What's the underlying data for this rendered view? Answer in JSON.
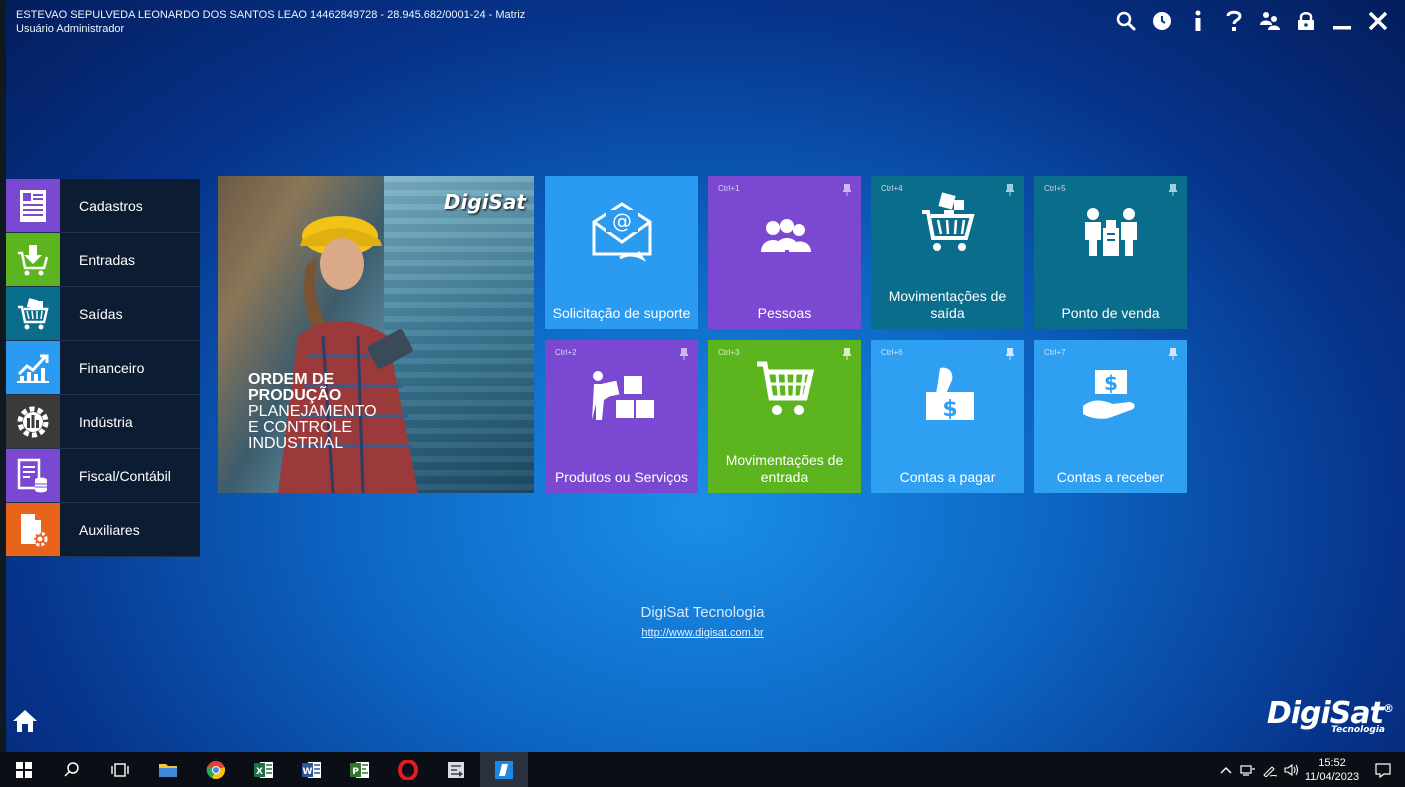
{
  "header": {
    "company_line": "ESTEVAO SEPULVEDA LEONARDO DOS SANTOS LEAO 14462849728 - 28.945.682/0001-24 - Matriz",
    "user_line": "Usuário Administrador"
  },
  "top_icons": [
    "search-icon",
    "history-icon",
    "info-icon",
    "help-icon",
    "switch-user-icon",
    "lock-icon",
    "minimize-icon",
    "close-icon"
  ],
  "menu": {
    "items": [
      {
        "label": "Cadastros",
        "color": "#7a48d1",
        "icon": "registry-icon"
      },
      {
        "label": "Entradas",
        "color": "#5cb51e",
        "icon": "cart-in-icon"
      },
      {
        "label": "Saídas",
        "color": "#0a6d8c",
        "icon": "cart-out-icon"
      },
      {
        "label": "Financeiro",
        "color": "#2b9bf1",
        "icon": "chart-icon"
      },
      {
        "label": "Indústria",
        "color": "#3a3a3a",
        "icon": "gear-icon"
      },
      {
        "label": "Fiscal/Contábil",
        "color": "#7a48d1",
        "icon": "tax-icon"
      },
      {
        "label": "Auxiliares",
        "color": "#e8631c",
        "icon": "aux-icon"
      }
    ]
  },
  "banner": {
    "logo": "DigiSat",
    "line1": "ORDEM DE",
    "line2": "PRODUÇÃO",
    "line3": "PLANEJAMENTO",
    "line4": "E CONTROLE",
    "line5": "INDUSTRIAL"
  },
  "tiles": {
    "suporte": {
      "label": "Solicitação de suporte",
      "shortcut": ""
    },
    "pessoas": {
      "label": "Pessoas",
      "shortcut": "Ctrl+1"
    },
    "mov_saida": {
      "label1": "Movimentações de",
      "label2": "saída",
      "shortcut": "Ctrl+4"
    },
    "pdv": {
      "label": "Ponto de venda",
      "shortcut": "Ctrl+5"
    },
    "produtos": {
      "label": "Produtos ou Serviços",
      "shortcut": "Ctrl+2"
    },
    "mov_entrada": {
      "label1": "Movimentações de",
      "label2": "entrada",
      "shortcut": "Ctrl+3"
    },
    "pagar": {
      "label": "Contas a pagar",
      "shortcut": "Ctrl+6"
    },
    "receber": {
      "label": "Contas a receber",
      "shortcut": "Ctrl+7"
    }
  },
  "footer": {
    "company": "DigiSat Tecnologia",
    "url": "http://www.digisat.com.br",
    "brand": "DigiSat",
    "brand_sub": "Tecnologia",
    "brand_mark": "®"
  },
  "taskbar": {
    "apps": [
      "windows-start-icon",
      "search-icon",
      "task-view-icon",
      "file-explorer-icon",
      "chrome-icon",
      "excel-icon",
      "word-icon",
      "project-icon",
      "opera-icon",
      "app-icon",
      "digisat-icon"
    ],
    "time": "15:52",
    "date": "11/04/2023"
  }
}
